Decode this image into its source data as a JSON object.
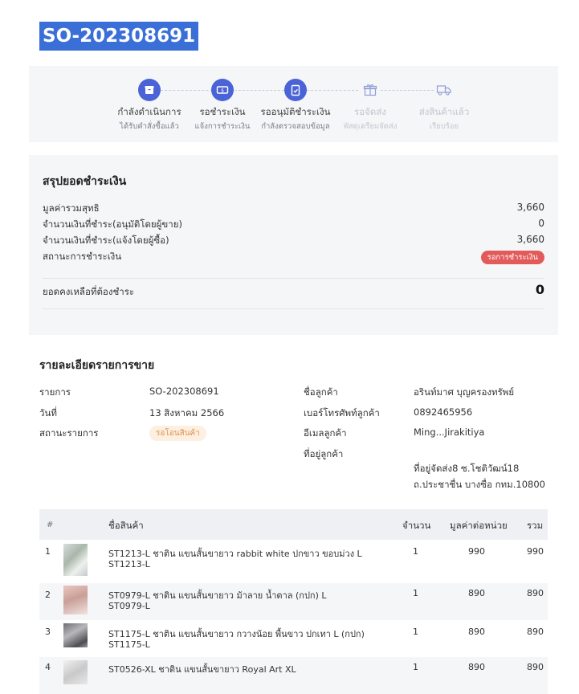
{
  "order": {
    "id": "SO-202308691"
  },
  "steps": [
    {
      "label": "กำลังดำเนินการ",
      "sub": "ได้รับคำสั่งซื้อแล้ว",
      "icon": "box-icon",
      "active": true
    },
    {
      "label": "รอชำระเงิน",
      "sub": "แจ้งการชำระเงิน",
      "icon": "money-icon",
      "active": true
    },
    {
      "label": "รออนุมัติชำระเงิน",
      "sub": "กำลังตรวจสอบข้อมูล",
      "icon": "document-check-icon",
      "active": true
    },
    {
      "label": "รอจัดส่ง",
      "sub": "พัสดุเตรียมจัดส่ง",
      "icon": "gift-icon",
      "active": false
    },
    {
      "label": "ส่งสินค้าแล้ว",
      "sub": "เรียบร้อย",
      "icon": "truck-icon",
      "active": false
    }
  ],
  "summary": {
    "title": "สรุปยอดชำระเงิน",
    "rows": [
      {
        "label": "มูลค่ารวมสุทธิ",
        "value": "3,660"
      },
      {
        "label": "จำนวนเงินที่ชำระ(อนุมัติโดยผู้ขาย)",
        "value": "0"
      },
      {
        "label": "จำนวนเงินที่ชำระ(แจ้งโดยผู้ซื้อ)",
        "value": "3,660"
      }
    ],
    "status_label": "สถานะการชำระเงิน",
    "status_badge": "รอการชำระเงิน",
    "balance_label": "ยอดคงเหลือที่ต้องชำระ",
    "balance_value": "0"
  },
  "details": {
    "title": "รายละเอียดรายการขาย",
    "item_label": "รายการ",
    "item_value": "SO-202308691",
    "date_label": "วันที่",
    "date_value": "13 สิงหาคม 2566",
    "status_label": "สถานะรายการ",
    "status_badge": "รอโอนสินค้า",
    "customer_label": "ชื่อลูกค้า",
    "customer_value": "อรินท์มาศ บุญครองทรัพย์",
    "phone_label": "เบอร์โทรศัพท์ลูกค้า",
    "phone_value": "0892465956",
    "email_label": "อีเมลลูกค้า",
    "email_value": "Ming...Jirakitiya",
    "address_label": "ที่อยู่ลูกค้า",
    "shipping_line1": "ที่อยู่จัดส่ง8 ซ.โชติวัฒน์18",
    "shipping_line2": "ถ.ประชาชื่น บางซื่อ กทม.10800"
  },
  "table": {
    "headers": {
      "num": "#",
      "name": "ชื่อสินค้า",
      "qty": "จำนวน",
      "unit": "มูลค่าต่อหน่วย",
      "total": "รวม"
    },
    "rows": [
      {
        "num": "1",
        "name": "ST1213-L ชาติน แขนสั้นขายาว rabbit white ปกขาว ขอบม่วง L",
        "sku": "ST1213-L",
        "qty": "1",
        "unit": "990",
        "total": "990"
      },
      {
        "num": "2",
        "name": "ST0979-L ชาติน แขนสั้นขายาว ม้าลาย น้ำตาล (กปก) L",
        "sku": "ST0979-L",
        "qty": "1",
        "unit": "890",
        "total": "890"
      },
      {
        "num": "3",
        "name": "ST1175-L ชาติน แขนสั้นขายาว กวางน้อย พื้นขาว ปกเทา L (กปก)",
        "sku": "ST1175-L",
        "qty": "1",
        "unit": "890",
        "total": "890"
      },
      {
        "num": "4",
        "name": "ST0526-XL ชาติน แขนสั้นขายาว Royal Art XL",
        "sku": "",
        "qty": "1",
        "unit": "890",
        "total": "890"
      }
    ]
  },
  "colors": {
    "accent": "#4a63d6",
    "title_bg": "#3a6fd8",
    "danger": "#e25a5a",
    "warning": "#e0944a"
  }
}
